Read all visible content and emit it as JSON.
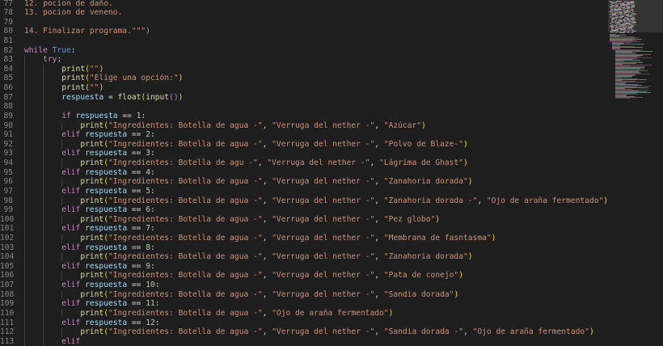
{
  "editor": {
    "first_line": 77,
    "lines": [
      {
        "t": [
          {
            "c": "st",
            "x": "12. pocion de daño."
          }
        ]
      },
      {
        "t": [
          {
            "c": "st",
            "x": "13. pocion de veneno."
          }
        ]
      },
      {
        "t": []
      },
      {
        "t": [
          {
            "c": "st",
            "x": "14. Finalizar programa.\"\"\")"
          }
        ]
      },
      {
        "t": []
      },
      {
        "t": [
          {
            "c": "kw",
            "x": "while"
          },
          {
            "c": "pl",
            "x": " "
          },
          {
            "c": "kb",
            "x": "True"
          },
          {
            "c": "pl",
            "x": ":"
          }
        ]
      },
      {
        "t": [
          {
            "c": "pl",
            "x": "    "
          },
          {
            "c": "kw",
            "x": "try"
          },
          {
            "c": "pl",
            "x": ":"
          }
        ]
      },
      {
        "t": [
          {
            "c": "pl",
            "x": "        "
          },
          {
            "c": "fn",
            "x": "print"
          },
          {
            "c": "p1",
            "x": "("
          },
          {
            "c": "st",
            "x": "\"\""
          },
          {
            "c": "p1",
            "x": ")"
          }
        ]
      },
      {
        "t": [
          {
            "c": "pl",
            "x": "        "
          },
          {
            "c": "fn",
            "x": "print"
          },
          {
            "c": "p1",
            "x": "("
          },
          {
            "c": "st",
            "x": "\"Elige una opción:\""
          },
          {
            "c": "p1",
            "x": ")"
          }
        ]
      },
      {
        "t": [
          {
            "c": "pl",
            "x": "        "
          },
          {
            "c": "fn",
            "x": "print"
          },
          {
            "c": "p1",
            "x": "("
          },
          {
            "c": "st",
            "x": "\"\""
          },
          {
            "c": "p1",
            "x": ")"
          }
        ]
      },
      {
        "t": [
          {
            "c": "pl",
            "x": "        "
          },
          {
            "c": "vr",
            "x": "respuesta"
          },
          {
            "c": "pl",
            "x": " = "
          },
          {
            "c": "fn",
            "x": "float"
          },
          {
            "c": "p1",
            "x": "("
          },
          {
            "c": "fn",
            "x": "input"
          },
          {
            "c": "p2",
            "x": "()"
          },
          {
            "c": "p1",
            "x": ")"
          }
        ]
      },
      {
        "t": []
      },
      {
        "t": [
          {
            "c": "pl",
            "x": "        "
          },
          {
            "c": "kw",
            "x": "if"
          },
          {
            "c": "pl",
            "x": " "
          },
          {
            "c": "vr",
            "x": "respuesta"
          },
          {
            "c": "pl",
            "x": " == "
          },
          {
            "c": "nm",
            "x": "1"
          },
          {
            "c": "pl",
            "x": ":"
          }
        ]
      },
      {
        "t": [
          {
            "c": "pl",
            "x": "            "
          },
          {
            "c": "fn",
            "x": "print"
          },
          {
            "c": "p1",
            "x": "("
          },
          {
            "c": "st",
            "x": "\"Ingredientes: Botella de agua -\""
          },
          {
            "c": "pl",
            "x": ", "
          },
          {
            "c": "st",
            "x": "\"Verruga del nether -\""
          },
          {
            "c": "pl",
            "x": ", "
          },
          {
            "c": "st",
            "x": "\"Azúcar\""
          },
          {
            "c": "p1",
            "x": ")"
          }
        ]
      },
      {
        "t": [
          {
            "c": "pl",
            "x": "        "
          },
          {
            "c": "kw",
            "x": "elif"
          },
          {
            "c": "pl",
            "x": " "
          },
          {
            "c": "vr",
            "x": "respuesta"
          },
          {
            "c": "pl",
            "x": " == "
          },
          {
            "c": "nm",
            "x": "2"
          },
          {
            "c": "pl",
            "x": ":"
          }
        ]
      },
      {
        "t": [
          {
            "c": "pl",
            "x": "            "
          },
          {
            "c": "fn",
            "x": "print"
          },
          {
            "c": "p1",
            "x": "("
          },
          {
            "c": "st",
            "x": "\"Ingredientes: Botella de agua -\""
          },
          {
            "c": "pl",
            "x": ", "
          },
          {
            "c": "st",
            "x": "\"Verruga del nether -\""
          },
          {
            "c": "pl",
            "x": ", "
          },
          {
            "c": "st",
            "x": "\"Polvo de Blaze-\""
          },
          {
            "c": "p1",
            "x": ")"
          }
        ]
      },
      {
        "t": [
          {
            "c": "pl",
            "x": "        "
          },
          {
            "c": "kw",
            "x": "elif"
          },
          {
            "c": "pl",
            "x": " "
          },
          {
            "c": "vr",
            "x": "respuesta"
          },
          {
            "c": "pl",
            "x": " == "
          },
          {
            "c": "nm",
            "x": "3"
          },
          {
            "c": "pl",
            "x": ":"
          }
        ]
      },
      {
        "t": [
          {
            "c": "pl",
            "x": "            "
          },
          {
            "c": "fn",
            "x": "print"
          },
          {
            "c": "p1",
            "x": "("
          },
          {
            "c": "st",
            "x": "\"Ingredientes: Botella de agu -\""
          },
          {
            "c": "pl",
            "x": ", "
          },
          {
            "c": "st",
            "x": "\"Verruga del nether -\""
          },
          {
            "c": "pl",
            "x": ", "
          },
          {
            "c": "st",
            "x": "\"Lágrima de Ghast\""
          },
          {
            "c": "p1",
            "x": ")"
          }
        ]
      },
      {
        "t": [
          {
            "c": "pl",
            "x": "        "
          },
          {
            "c": "kw",
            "x": "elif"
          },
          {
            "c": "pl",
            "x": " "
          },
          {
            "c": "vr",
            "x": "respuesta"
          },
          {
            "c": "pl",
            "x": " == "
          },
          {
            "c": "nm",
            "x": "4"
          },
          {
            "c": "pl",
            "x": ":"
          }
        ]
      },
      {
        "t": [
          {
            "c": "pl",
            "x": "            "
          },
          {
            "c": "fn",
            "x": "print"
          },
          {
            "c": "p1",
            "x": "("
          },
          {
            "c": "st",
            "x": "\"Ingredientes: Botella de agua -\""
          },
          {
            "c": "pl",
            "x": ", "
          },
          {
            "c": "st",
            "x": "\"Verruga del nether -\""
          },
          {
            "c": "pl",
            "x": ", "
          },
          {
            "c": "st",
            "x": "\"Zanahoria dorada\""
          },
          {
            "c": "p1",
            "x": ")"
          }
        ]
      },
      {
        "t": [
          {
            "c": "pl",
            "x": "        "
          },
          {
            "c": "kw",
            "x": "elif"
          },
          {
            "c": "pl",
            "x": " "
          },
          {
            "c": "vr",
            "x": "respuesta"
          },
          {
            "c": "pl",
            "x": " == "
          },
          {
            "c": "nm",
            "x": "5"
          },
          {
            "c": "pl",
            "x": ":"
          }
        ]
      },
      {
        "t": [
          {
            "c": "pl",
            "x": "            "
          },
          {
            "c": "fn",
            "x": "print"
          },
          {
            "c": "p1",
            "x": "("
          },
          {
            "c": "st",
            "x": "\"Ingredientes: Botella de agua -\""
          },
          {
            "c": "pl",
            "x": ", "
          },
          {
            "c": "st",
            "x": "\"Verruga del nether -\""
          },
          {
            "c": "pl",
            "x": ", "
          },
          {
            "c": "st",
            "x": "\"Zanahoria dorada -\""
          },
          {
            "c": "pl",
            "x": ", "
          },
          {
            "c": "st",
            "x": "\"Ojo de araña fermentado\""
          },
          {
            "c": "p1",
            "x": ")"
          }
        ]
      },
      {
        "t": [
          {
            "c": "pl",
            "x": "        "
          },
          {
            "c": "kw",
            "x": "elif"
          },
          {
            "c": "pl",
            "x": " "
          },
          {
            "c": "vr",
            "x": "respuesta"
          },
          {
            "c": "pl",
            "x": " == "
          },
          {
            "c": "nm",
            "x": "6"
          },
          {
            "c": "pl",
            "x": ":"
          }
        ]
      },
      {
        "t": [
          {
            "c": "pl",
            "x": "            "
          },
          {
            "c": "fn",
            "x": "print"
          },
          {
            "c": "p1",
            "x": "("
          },
          {
            "c": "st",
            "x": "\"Ingredientes: Botella de agua -\""
          },
          {
            "c": "pl",
            "x": ", "
          },
          {
            "c": "st",
            "x": "\"Verruga del nether -\""
          },
          {
            "c": "pl",
            "x": ", "
          },
          {
            "c": "st",
            "x": "\"Pez globo\""
          },
          {
            "c": "p1",
            "x": ")"
          }
        ]
      },
      {
        "t": [
          {
            "c": "pl",
            "x": "        "
          },
          {
            "c": "kw",
            "x": "elif"
          },
          {
            "c": "pl",
            "x": " "
          },
          {
            "c": "vr",
            "x": "respuesta"
          },
          {
            "c": "pl",
            "x": " == "
          },
          {
            "c": "nm",
            "x": "7"
          },
          {
            "c": "pl",
            "x": ":"
          }
        ]
      },
      {
        "t": [
          {
            "c": "pl",
            "x": "            "
          },
          {
            "c": "fn",
            "x": "print"
          },
          {
            "c": "p1",
            "x": "("
          },
          {
            "c": "st",
            "x": "\"Ingredientes: Botella de agua -\""
          },
          {
            "c": "pl",
            "x": ", "
          },
          {
            "c": "st",
            "x": "\"Verruga del nether -\""
          },
          {
            "c": "pl",
            "x": ", "
          },
          {
            "c": "st",
            "x": "\"Membrana de fasntasma\""
          },
          {
            "c": "p1",
            "x": ")"
          }
        ]
      },
      {
        "t": [
          {
            "c": "pl",
            "x": "        "
          },
          {
            "c": "kw",
            "x": "elif"
          },
          {
            "c": "pl",
            "x": " "
          },
          {
            "c": "vr",
            "x": "respuesta"
          },
          {
            "c": "pl",
            "x": " == "
          },
          {
            "c": "nm",
            "x": "8"
          },
          {
            "c": "pl",
            "x": ":"
          }
        ]
      },
      {
        "t": [
          {
            "c": "pl",
            "x": "            "
          },
          {
            "c": "fn",
            "x": "print"
          },
          {
            "c": "p1",
            "x": "("
          },
          {
            "c": "st",
            "x": "\"Ingredientes: Botella de agua -\""
          },
          {
            "c": "pl",
            "x": ", "
          },
          {
            "c": "st",
            "x": "\"Verruga del nether -\""
          },
          {
            "c": "pl",
            "x": ", "
          },
          {
            "c": "st",
            "x": "\"Zanahoria dorada\""
          },
          {
            "c": "p1",
            "x": ")"
          }
        ]
      },
      {
        "t": [
          {
            "c": "pl",
            "x": "        "
          },
          {
            "c": "kw",
            "x": "elif"
          },
          {
            "c": "pl",
            "x": " "
          },
          {
            "c": "vr",
            "x": "respuesta"
          },
          {
            "c": "pl",
            "x": " == "
          },
          {
            "c": "nm",
            "x": "9"
          },
          {
            "c": "pl",
            "x": ":"
          }
        ]
      },
      {
        "t": [
          {
            "c": "pl",
            "x": "            "
          },
          {
            "c": "fn",
            "x": "print"
          },
          {
            "c": "p1",
            "x": "("
          },
          {
            "c": "st",
            "x": "\"Ingredientes: Botella de agua -\""
          },
          {
            "c": "pl",
            "x": ", "
          },
          {
            "c": "st",
            "x": "\"Verruga del nether -\""
          },
          {
            "c": "pl",
            "x": ", "
          },
          {
            "c": "st",
            "x": "\"Pata de conejo\""
          },
          {
            "c": "p1",
            "x": ")"
          }
        ]
      },
      {
        "t": [
          {
            "c": "pl",
            "x": "        "
          },
          {
            "c": "kw",
            "x": "elif"
          },
          {
            "c": "pl",
            "x": " "
          },
          {
            "c": "vr",
            "x": "respuesta"
          },
          {
            "c": "pl",
            "x": " == "
          },
          {
            "c": "nm",
            "x": "10"
          },
          {
            "c": "pl",
            "x": ":"
          }
        ]
      },
      {
        "t": [
          {
            "c": "pl",
            "x": "            "
          },
          {
            "c": "fn",
            "x": "print"
          },
          {
            "c": "p1",
            "x": "("
          },
          {
            "c": "st",
            "x": "\"Ingredientes: Botella de agua -\""
          },
          {
            "c": "pl",
            "x": ", "
          },
          {
            "c": "st",
            "x": "\"Verruga del nether -\""
          },
          {
            "c": "pl",
            "x": ", "
          },
          {
            "c": "st",
            "x": "\"Sandia dorada\""
          },
          {
            "c": "p1",
            "x": ")"
          }
        ]
      },
      {
        "t": [
          {
            "c": "pl",
            "x": "        "
          },
          {
            "c": "kw",
            "x": "elif"
          },
          {
            "c": "pl",
            "x": " "
          },
          {
            "c": "vr",
            "x": "respuesta"
          },
          {
            "c": "pl",
            "x": " == "
          },
          {
            "c": "nm",
            "x": "11"
          },
          {
            "c": "pl",
            "x": ":"
          }
        ]
      },
      {
        "t": [
          {
            "c": "pl",
            "x": "            "
          },
          {
            "c": "fn",
            "x": "print"
          },
          {
            "c": "p1",
            "x": "("
          },
          {
            "c": "st",
            "x": "\"Ingredientes: Botella de agua -\""
          },
          {
            "c": "pl",
            "x": ", "
          },
          {
            "c": "st",
            "x": "\"Ojo de araña fermentado\""
          },
          {
            "c": "p1",
            "x": ")"
          }
        ]
      },
      {
        "t": [
          {
            "c": "pl",
            "x": "        "
          },
          {
            "c": "kw",
            "x": "elif"
          },
          {
            "c": "pl",
            "x": " "
          },
          {
            "c": "vr",
            "x": "respuesta"
          },
          {
            "c": "pl",
            "x": " == "
          },
          {
            "c": "nm",
            "x": "12"
          },
          {
            "c": "pl",
            "x": ":"
          }
        ]
      },
      {
        "t": [
          {
            "c": "pl",
            "x": "            "
          },
          {
            "c": "fn",
            "x": "print"
          },
          {
            "c": "p1",
            "x": "("
          },
          {
            "c": "st",
            "x": "\"Ingredientes: Botella de agua -\""
          },
          {
            "c": "pl",
            "x": ", "
          },
          {
            "c": "st",
            "x": "\"Verruga del nether -\""
          },
          {
            "c": "pl",
            "x": ", "
          },
          {
            "c": "st",
            "x": "\"Sandia dorada -\""
          },
          {
            "c": "pl",
            "x": ", "
          },
          {
            "c": "st",
            "x": "\"Ojo de araña fermentado\""
          },
          {
            "c": "p1",
            "x": ")"
          }
        ]
      },
      {
        "t": [
          {
            "c": "pl",
            "x": "        "
          },
          {
            "c": "kw",
            "x": "elif"
          }
        ]
      }
    ]
  },
  "theme": {
    "background": "#1e1e1e",
    "keyword": "#c586c0",
    "builtin_constant": "#569cd6",
    "function": "#dcdcaa",
    "variable": "#9cdcfe",
    "number": "#b5cea8",
    "string": "#ce9178",
    "bracket_level1": "#ffd700",
    "bracket_level2": "#da70d6",
    "line_number": "#858585"
  }
}
